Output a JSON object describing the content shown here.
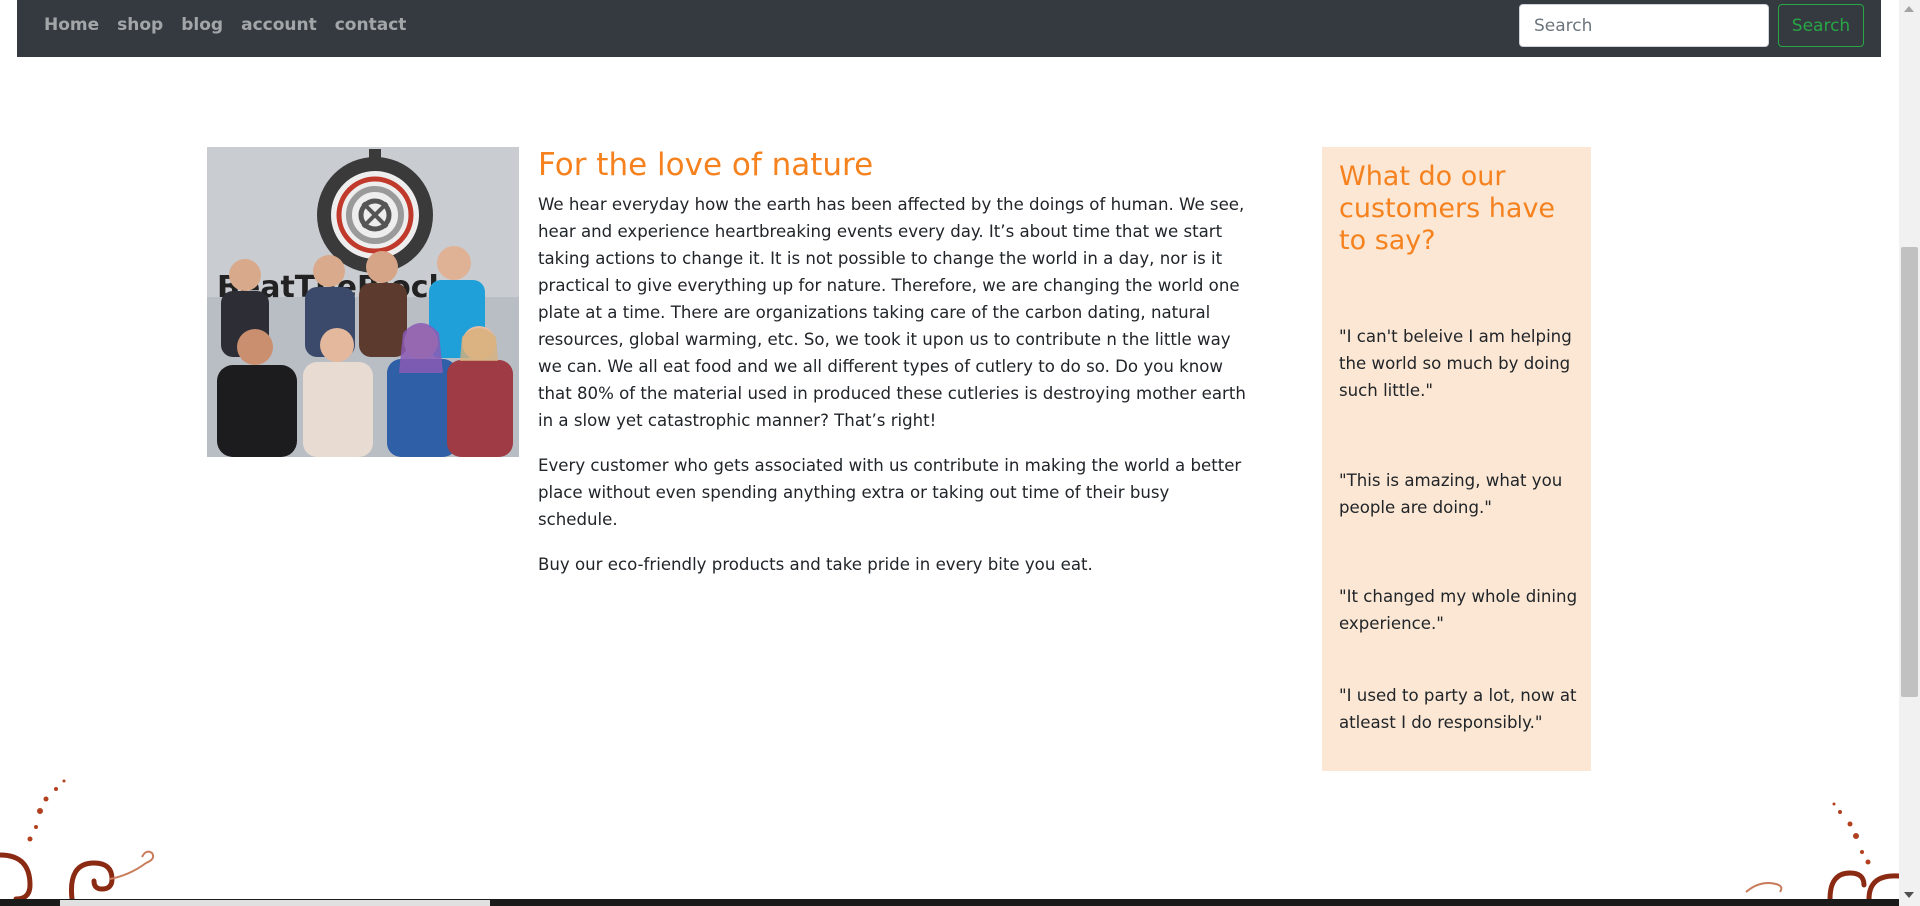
{
  "nav": {
    "links": [
      "Home",
      "shop",
      "blog",
      "account",
      "contact"
    ],
    "search_placeholder": "Search",
    "search_button": "Search"
  },
  "article": {
    "title": "For the love of nature",
    "paragraphs": [
      "We hear everyday how the earth has been affected by the doings of human. We see, hear and experience heartbreaking events every day. It’s about time that we start taking actions to change it. It is not possible to change the world in a day, nor is it practical to give everything up for nature. Therefore, we are changing the world one plate at a time. There are organizations taking care of the carbon dating, natural resources, global warming, etc. So, we took it upon us to contribute n the little way we can. We all eat food and we all different types of cutlery to do so. Do you know that 80% of the material used in produced these cutleries is destroying mother earth in a slow yet catastrophic manner? That’s right!",
      "Every customer who gets associated with us contribute in making the world a better place without even spending anything extra or taking out time of their busy schedule.",
      "Buy our eco-friendly products and take pride in every bite you eat."
    ]
  },
  "photo": {
    "sign_text": "BeatTheBlock"
  },
  "testimonials": {
    "title": "What do our customers have to say?",
    "quotes": [
      "\"I can't beleive I am helping the world so much by doing such little.\"",
      "\"This is amazing, what you people are doing.\"",
      "\"It changed my whole dining experience.\"",
      "\"I used to party a lot, now at atleast I do responsibly.\""
    ]
  },
  "colors": {
    "navbar": "#343a40",
    "accent_orange": "#f5821f",
    "search_green": "#28a745",
    "testimonial_bg": "#fbe7d3"
  }
}
